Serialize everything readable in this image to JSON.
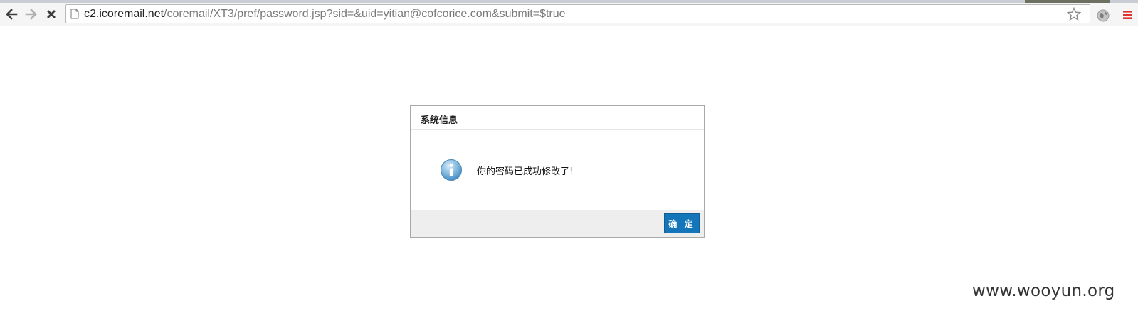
{
  "browser": {
    "url_host": "c2.icoremail.net",
    "url_rest": "/coremail/XT3/pref/password.jsp?sid=&uid=yitian@cofcorice.com&submit=$true",
    "icons": [
      "back-icon",
      "forward-icon",
      "stop-icon",
      "page-icon",
      "star-icon",
      "extension-icon",
      "menu-icon"
    ],
    "menu_color": "#e03030"
  },
  "dialog": {
    "title": "系统信息",
    "message": "你的密码已成功修改了!",
    "ok_label": "确 定",
    "ok_color": "#1476b9",
    "icon": "info-icon"
  },
  "watermark": "www.wooyun.org"
}
